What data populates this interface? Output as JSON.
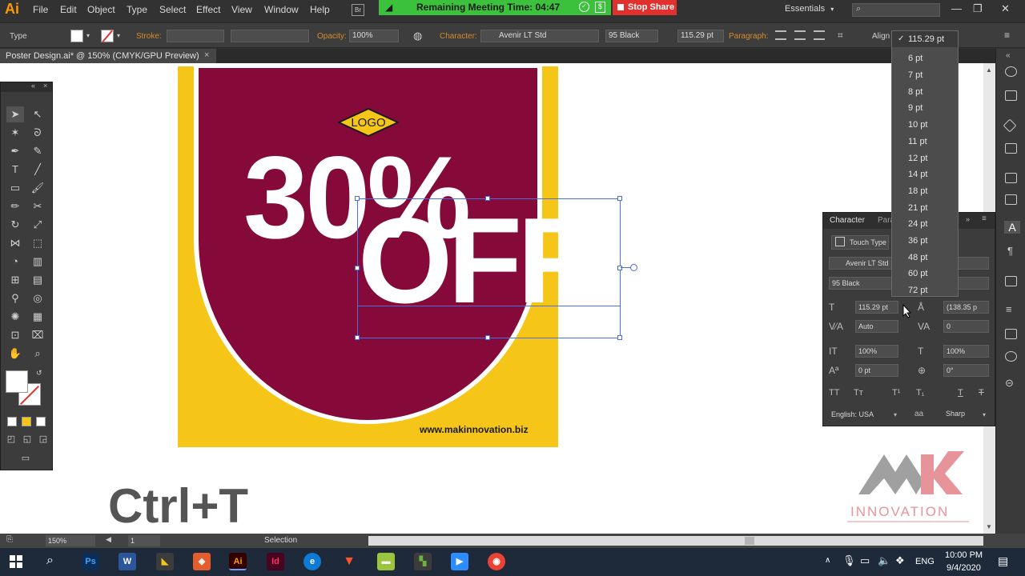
{
  "app": {
    "logo": "Ai",
    "brand_color": "#ff9a00"
  },
  "menu": {
    "items": [
      "File",
      "Edit",
      "Object",
      "Type",
      "Select",
      "Effect",
      "View",
      "Window",
      "Help"
    ],
    "bridge_label": "Br",
    "workspace": "Essentials"
  },
  "meeting": {
    "text": "Remaining Meeting Time: 04:47",
    "stop_label": "Stop Share",
    "bar_color": "#3cc13c",
    "stop_color": "#e0312f"
  },
  "control_bar": {
    "tool_label": "Type",
    "stroke_label": "Stroke:",
    "opacity_label": "Opacity:",
    "opacity_value": "100%",
    "character_label": "Character:",
    "font_family": "Avenir LT Std",
    "font_style": "95 Black",
    "font_size": "115.29 pt",
    "paragraph_label": "Paragraph:",
    "align_label": "Align"
  },
  "document": {
    "tab_title": "Poster Design.ai* @ 150% (CMYK/GPU Preview)",
    "close_glyph": "×"
  },
  "poster": {
    "logo_text": "LOGO",
    "headline_1": "30%",
    "headline_2": "OFF",
    "website": "www.makinnovation.biz",
    "maroon": "#850a3a",
    "yellow": "#f5c518"
  },
  "overlay": {
    "shortcut": "Ctrl+T"
  },
  "brand": {
    "name": "INNOVATION",
    "color": "#e6949a"
  },
  "character_panel": {
    "tab_character": "Character",
    "tab_paragraph": "Para",
    "touch_type": "Touch Type",
    "font_family": "Avenir LT Std",
    "font_style": "95 Black",
    "font_size": "115.29 pt",
    "leading": "(138.35 p",
    "kerning": "Auto",
    "tracking": "0",
    "vertical_scale": "100%",
    "horizontal_scale": "100%",
    "baseline_shift": "0 pt",
    "rotation": "0°",
    "language": "English: USA",
    "antialias_label": "aa",
    "antialias": "Sharp"
  },
  "size_dropdown": {
    "selected": "115.29 pt",
    "check": "✓",
    "options": [
      "6 pt",
      "7 pt",
      "8 pt",
      "9 pt",
      "10 pt",
      "11 pt",
      "12 pt",
      "14 pt",
      "18 pt",
      "21 pt",
      "24 pt",
      "36 pt",
      "48 pt",
      "60 pt",
      "72 pt"
    ]
  },
  "status_bar": {
    "zoom": "150%",
    "page": "1",
    "tool_status": "Selection"
  },
  "taskbar": {
    "apps": [
      "Ps",
      "W",
      "",
      "",
      "Ai",
      "Id",
      "",
      "",
      "",
      "",
      "",
      ""
    ],
    "language": "ENG",
    "time": "10:00 PM",
    "date": "9/4/2020"
  }
}
